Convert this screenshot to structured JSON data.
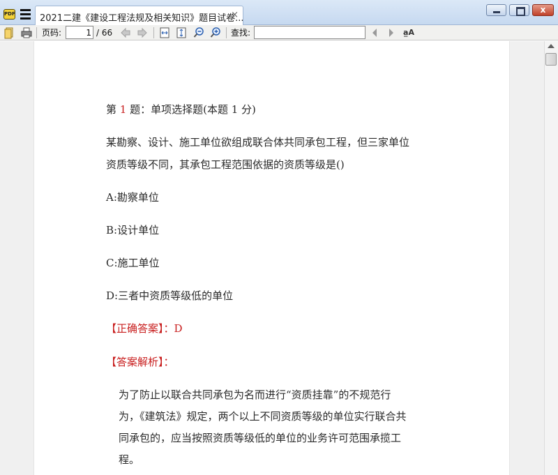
{
  "window": {
    "tab_title": "2021二建《建设工程法规及相关知识》题目试卷...",
    "tab_close": "×",
    "app_icon_text": "PDF",
    "close_glyph": "x"
  },
  "toolbar": {
    "page_label": "页码:",
    "page_value": "1",
    "page_total": "/ 66",
    "find_label": "查找:",
    "find_value": "",
    "match_case_glyph": "a̲A"
  },
  "question": {
    "number_prefix": "第 ",
    "number": "1",
    "number_suffix": " 题：单项选择题(本题 1 分)",
    "stem_lines": [
      "某勘察、设计、施工单位欲组成联合体共同承包工程，但三家单位",
      "资质等级不同，其承包工程范围依据的资质等级是()"
    ],
    "options": [
      "A:勘察单位",
      "B:设计单位",
      "C:施工单位",
      "D:三者中资质等级低的单位"
    ],
    "answer_label": "【正确答案】：D",
    "analysis_label": "【答案解析】：",
    "analysis_lines": [
      "为了防止以联合共同承包为名而进行“资质挂靠”的不规范行",
      "为，《建筑法》规定，两个以上不同资质等级的单位实行联合共",
      "同承包的，应当按照资质等级低的单位的业务许可范围承揽工",
      "程。"
    ]
  },
  "colors": {
    "accent_red": "#c81e1e",
    "text": "#2a2a2a"
  }
}
